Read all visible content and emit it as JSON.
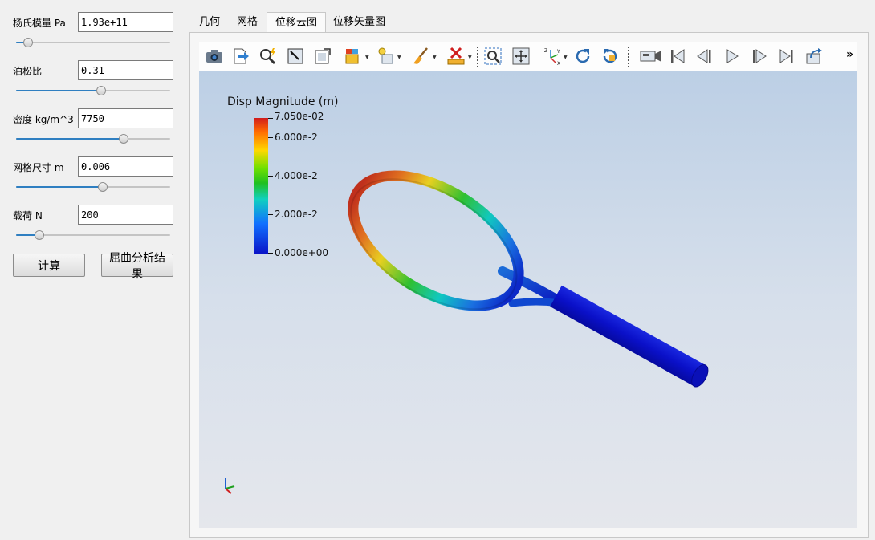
{
  "params": [
    {
      "label": "杨氏模量 Pa",
      "value": "1.93e+11",
      "slider": 0.08
    },
    {
      "label": "泊松比",
      "value": "0.31",
      "slider": 0.55
    },
    {
      "label": "密度 kg/m^3",
      "value": "7750",
      "slider": 0.7
    },
    {
      "label": "网格尺寸 m",
      "value": "0.006",
      "slider": 0.56
    },
    {
      "label": "载荷 N",
      "value": "200",
      "slider": 0.15
    }
  ],
  "buttons": {
    "compute": "计算",
    "buckling": "屈曲分析结果"
  },
  "tabs": [
    "几何",
    "网格",
    "位移云图",
    "位移矢量图"
  ],
  "active_tab": "位移云图",
  "toolbar": {
    "icons": [
      "camera-icon",
      "export-icon",
      "find-data-icon",
      "select-cells-icon",
      "select-points-icon",
      "block-selection-icon",
      "interactive-select-icon",
      "clear-selection-icon",
      "ruler-delete-icon",
      "zoom-to-box-icon",
      "reset-camera-icon",
      "axes-orientation-icon",
      "rotate-ccw-icon",
      "rotate-cw-icon",
      "video-camera-icon",
      "first-frame-icon",
      "previous-frame-icon",
      "play-icon",
      "next-frame-icon",
      "last-frame-icon",
      "loop-icon"
    ],
    "overflow": "»"
  },
  "legend": {
    "title": "Disp Magnitude (m)",
    "labels": [
      "7.050e-02",
      "6.000e-2",
      "4.000e-2",
      "2.000e-2",
      "0.000e+00"
    ]
  },
  "colors": {
    "accent": "#2f7fc1",
    "viewport_top": "#bccfe5",
    "viewport_bottom": "#e5e7ec",
    "handle_blue": "#0a10c8"
  }
}
